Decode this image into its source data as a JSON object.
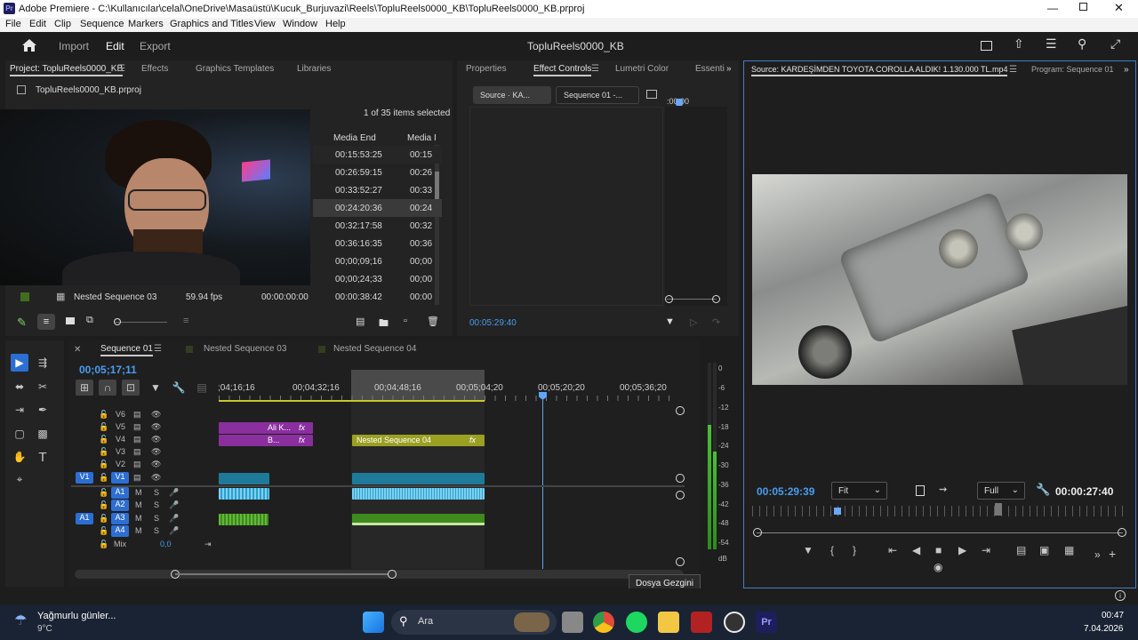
{
  "window": {
    "title": "Adobe Premiere - C:\\Kullanıcılar\\celal\\OneDrive\\Masaüstü\\Kucuk_Burjuvazi\\Reels\\TopluReels0000_KB\\TopluReels0000_KB.prproj"
  },
  "menu": [
    "File",
    "Edit",
    "Clip",
    "Sequence",
    "Markers",
    "Graphics and Titles",
    "View",
    "Window",
    "Help"
  ],
  "header": {
    "tabs": [
      "Import",
      "Edit",
      "Export"
    ],
    "project_name": "TopluReels0000_KB"
  },
  "project": {
    "tab_label": "Project: TopluReels0000_KB",
    "tabs": [
      "Effects",
      "Graphics Templates",
      "Libraries"
    ],
    "file": "TopluReels0000_KB.prproj",
    "selection": "1 of 35 items selected",
    "col_media_end": "Media End",
    "col_media_in": "Media I",
    "rows": [
      {
        "end": "00:15:53:25",
        "in": "00:15"
      },
      {
        "end": "00:26:59:15",
        "in": "00:26"
      },
      {
        "end": "00:33:52:27",
        "in": "00:33"
      },
      {
        "end": "00:24:20:36",
        "in": "00:24"
      },
      {
        "end": "00:32:17:58",
        "in": "00:32"
      },
      {
        "end": "00:36:16:35",
        "in": "00:36"
      },
      {
        "end": "00;00;09;16",
        "in": "00;00"
      },
      {
        "end": "00;00;24;33",
        "in": "00;00"
      },
      {
        "end": "00:00:38:42",
        "in": "00:00"
      }
    ],
    "bottom_row": {
      "name": "Nested Sequence 03",
      "fps": "59.94 fps",
      "start": "00:00:00:00"
    }
  },
  "effect_controls": {
    "tabs": [
      "Properties",
      "Effect Controls",
      "Lumetri Color",
      "Essenti"
    ],
    "source_btn": "Source · KA...",
    "seq_btn": "Sequence 01 -...",
    "ruler": ":00;00",
    "timecode": "00:05:29:40"
  },
  "source": {
    "tab_label": "Source: KARDEŞİMDEN TOYOTA COROLLA ALDIK! 1.130.000 TL.mp4",
    "program_tab": "Program: Sequence 01",
    "timecode": "00:05:29:39",
    "fit": "Fit",
    "quality": "Full",
    "duration": "00:00:27:40",
    "playhead_fraction": 0.22
  },
  "timeline": {
    "tabs": [
      "Sequence 01",
      "Nested Sequence 03",
      "Nested Sequence 04"
    ],
    "timecode": "00;05;17;11",
    "ruler": [
      ";04;16;16",
      "00;04;32;16",
      "00;04;48;16",
      "00;05;04;20",
      "00;05;20;20",
      "00;05;36;20"
    ],
    "video_tracks": [
      "V6",
      "V5",
      "V4",
      "V3",
      "V2",
      "V1"
    ],
    "audio_tracks": [
      "A1",
      "A2",
      "A3",
      "A4"
    ],
    "mix_label": "Mix",
    "mix_value": "0,0",
    "clips": {
      "v5": "Ali K...",
      "v4": "B...",
      "nested": "Nested Sequence 04",
      "fx": "fx"
    },
    "v1_source": "V1",
    "a1_source": "A1",
    "mute": "M",
    "solo": "S"
  },
  "meter": {
    "labels": [
      "0",
      "-6",
      "-12",
      "-18",
      "-24",
      "-30",
      "-36",
      "-42",
      "-48",
      "-54",
      "dB"
    ]
  },
  "tooltip": "Dosya Gezgini",
  "taskbar": {
    "weather_title": "Yağmurlu günler...",
    "weather_temp": "9°C",
    "search": "Ara",
    "time": "00:47",
    "date": "7.04.2026"
  },
  "colors": {
    "accent": "#2d8ceb",
    "purple": "#8a2f9e",
    "teal": "#1f7a99",
    "green": "#3f8a1e",
    "yellow_clip": "#9aa022"
  }
}
